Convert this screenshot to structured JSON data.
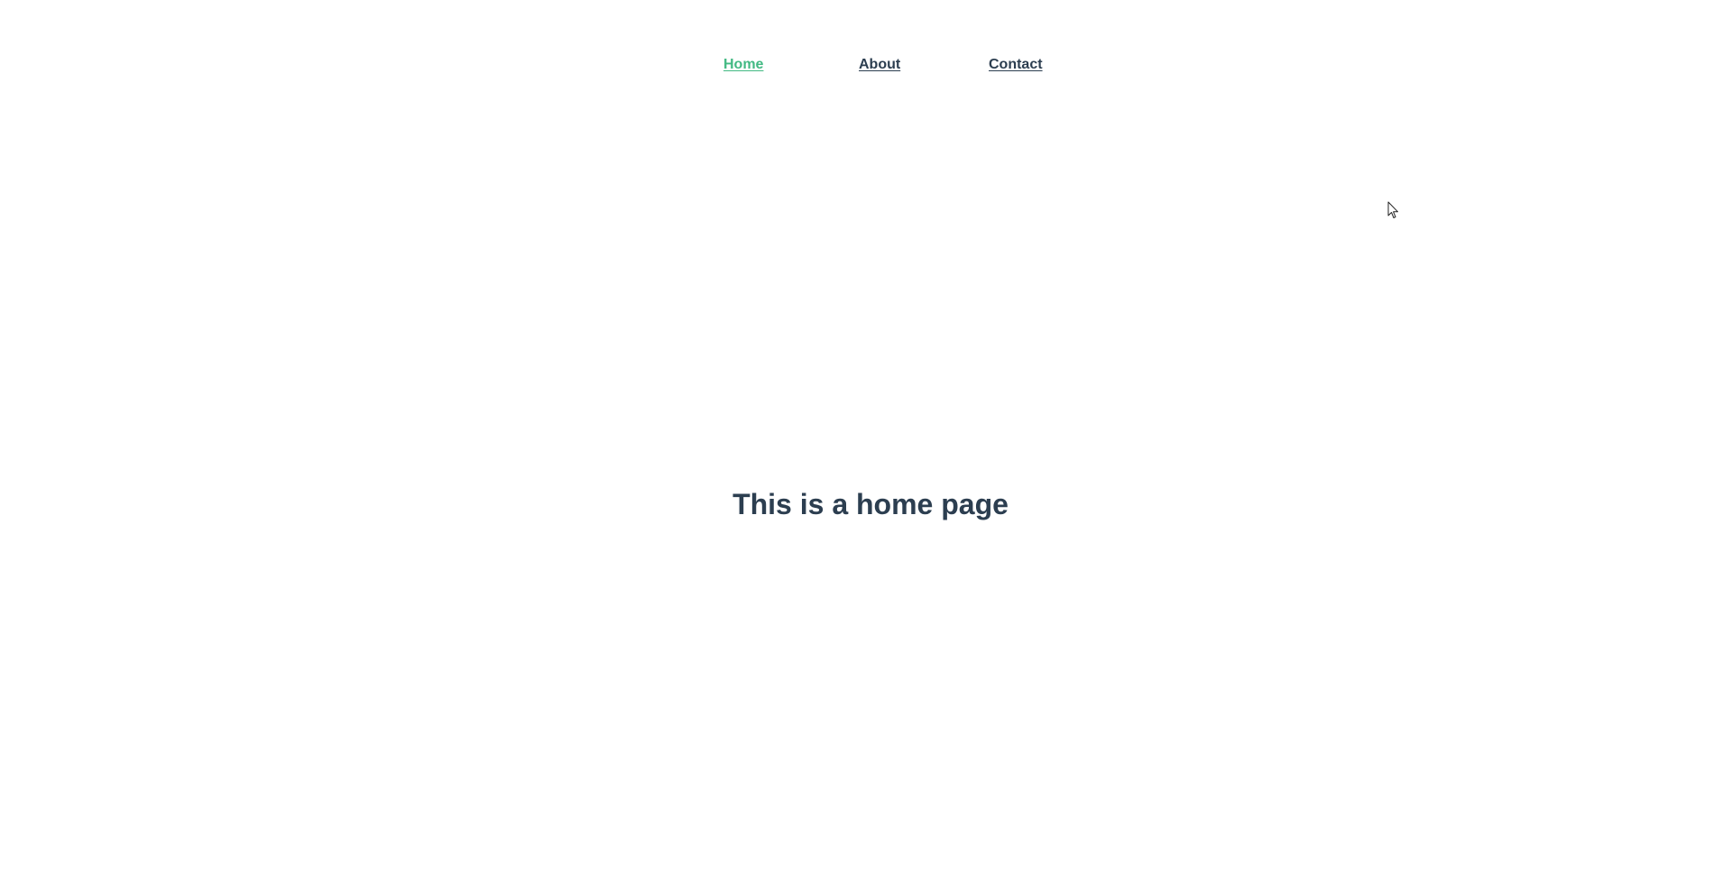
{
  "nav": {
    "items": [
      {
        "label": "Home",
        "active": true
      },
      {
        "label": "About",
        "active": false
      },
      {
        "label": "Contact",
        "active": false
      }
    ]
  },
  "main": {
    "heading": "This is a home page"
  },
  "colors": {
    "active_link": "#42b983",
    "text": "#2c3e50",
    "background": "#ffffff"
  },
  "icons": {
    "cursor": "mouse-pointer-icon"
  }
}
